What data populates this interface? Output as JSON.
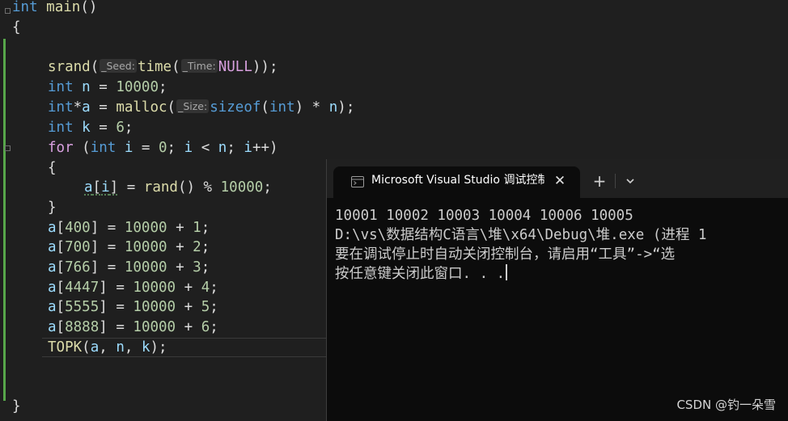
{
  "editor": {
    "lines": {
      "main_sig": {
        "type": "int",
        "name": "main",
        "parens": "()"
      },
      "open_brace": "{",
      "srand": {
        "fn": "srand",
        "hint_seed": "_Seed:",
        "fn_time": "time",
        "hint_time": "_Time:",
        "null": "NULL",
        "close": "));"
      },
      "int_n": {
        "type": "int",
        "var": "n",
        "eq": " = ",
        "num": "10000",
        "semi": ";"
      },
      "int_a": {
        "type": "int",
        "star": "*",
        "var": "a",
        "eq": " = ",
        "fn": "malloc",
        "open": "(",
        "hint_size": "_Size:",
        "sizeof": "sizeof",
        "inner_type": "int",
        "rest_a": ") * ",
        "var_n": "n",
        "rest_b": ");"
      },
      "int_k": {
        "type": "int",
        "var": "k",
        "eq": " = ",
        "num": "6",
        "semi": ";"
      },
      "for": {
        "kw": "for",
        "open": " (",
        "type": "int",
        "var_i": "i",
        "eq": " = ",
        "num": "0",
        "sep1": "; ",
        "var_i2": "i",
        "lt": " < ",
        "var_n": "n",
        "sep2": "; ",
        "var_i3": "i",
        "inc": "++)"
      },
      "inner_open": "{",
      "assign": {
        "var_a": "a",
        "open": "[",
        "var_i": "i",
        "close": "]",
        "eq": " = ",
        "fn": "rand",
        "rest": "() % ",
        "num": "10000",
        "semi": ";"
      },
      "inner_close": "}",
      "sets": [
        {
          "var": "a",
          "index": "400",
          "value": "10000",
          "add": "1"
        },
        {
          "var": "a",
          "index": "700",
          "value": "10000",
          "add": "2"
        },
        {
          "var": "a",
          "index": "766",
          "value": "10000",
          "add": "3"
        },
        {
          "var": "a",
          "index": "4447",
          "value": "10000",
          "add": "4"
        },
        {
          "var": "a",
          "index": "5555",
          "value": "10000",
          "add": "5"
        },
        {
          "var": "a",
          "index": "8888",
          "value": "10000",
          "add": "6"
        }
      ],
      "topk": {
        "fn": "TOPK",
        "open": "(",
        "a": "a",
        "c1": ", ",
        "n": "n",
        "c2": ", ",
        "k": "k",
        "close": ");"
      },
      "close_brace": "}"
    }
  },
  "terminal": {
    "tab_title": "Microsoft Visual Studio 调试控制台",
    "icon": "terminal-icon",
    "close_glyph": "✕",
    "new_tab_glyph": "+",
    "output": [
      "10001 10002 10003 10004 10006 10005",
      "D:\\vs\\数据结构C语言\\堆\\x64\\Debug\\堆.exe (进程 1",
      "要在调试停止时自动关闭控制台，请启用“工具”->“选",
      "按任意键关闭此窗口. . ."
    ]
  },
  "watermark": "CSDN @钓一朵雪",
  "colors": {
    "editor_bg": "#1f1f1f",
    "keyword": "#569cd6",
    "control_keyword": "#d8a0df",
    "function": "#dcdcaa",
    "variable": "#9cdcfe",
    "number": "#b5cea8",
    "terminal_bg": "#0c0c0c",
    "change_bar": "#57a64a"
  }
}
